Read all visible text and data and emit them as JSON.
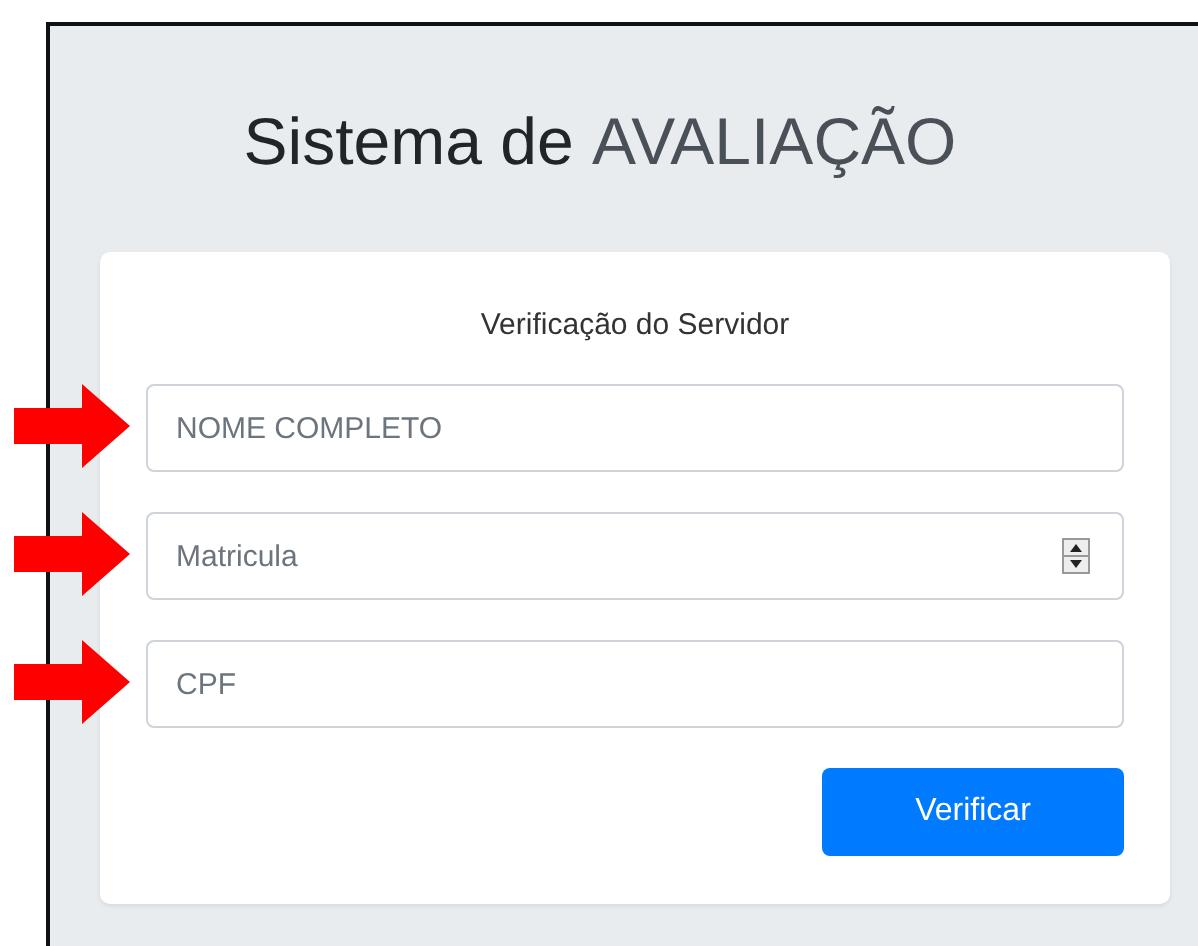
{
  "title": {
    "lead": "Sistema de",
    "accent": "AVALIAÇÃO"
  },
  "form": {
    "heading": "Verificação do Servidor",
    "fields": [
      {
        "kind": "text",
        "placeholder": "NOME COMPLETO",
        "highlighted": true
      },
      {
        "kind": "number",
        "placeholder": "Matricula",
        "highlighted": true
      },
      {
        "kind": "text",
        "placeholder": "CPF",
        "highlighted": true
      }
    ],
    "button": "Verificar"
  }
}
